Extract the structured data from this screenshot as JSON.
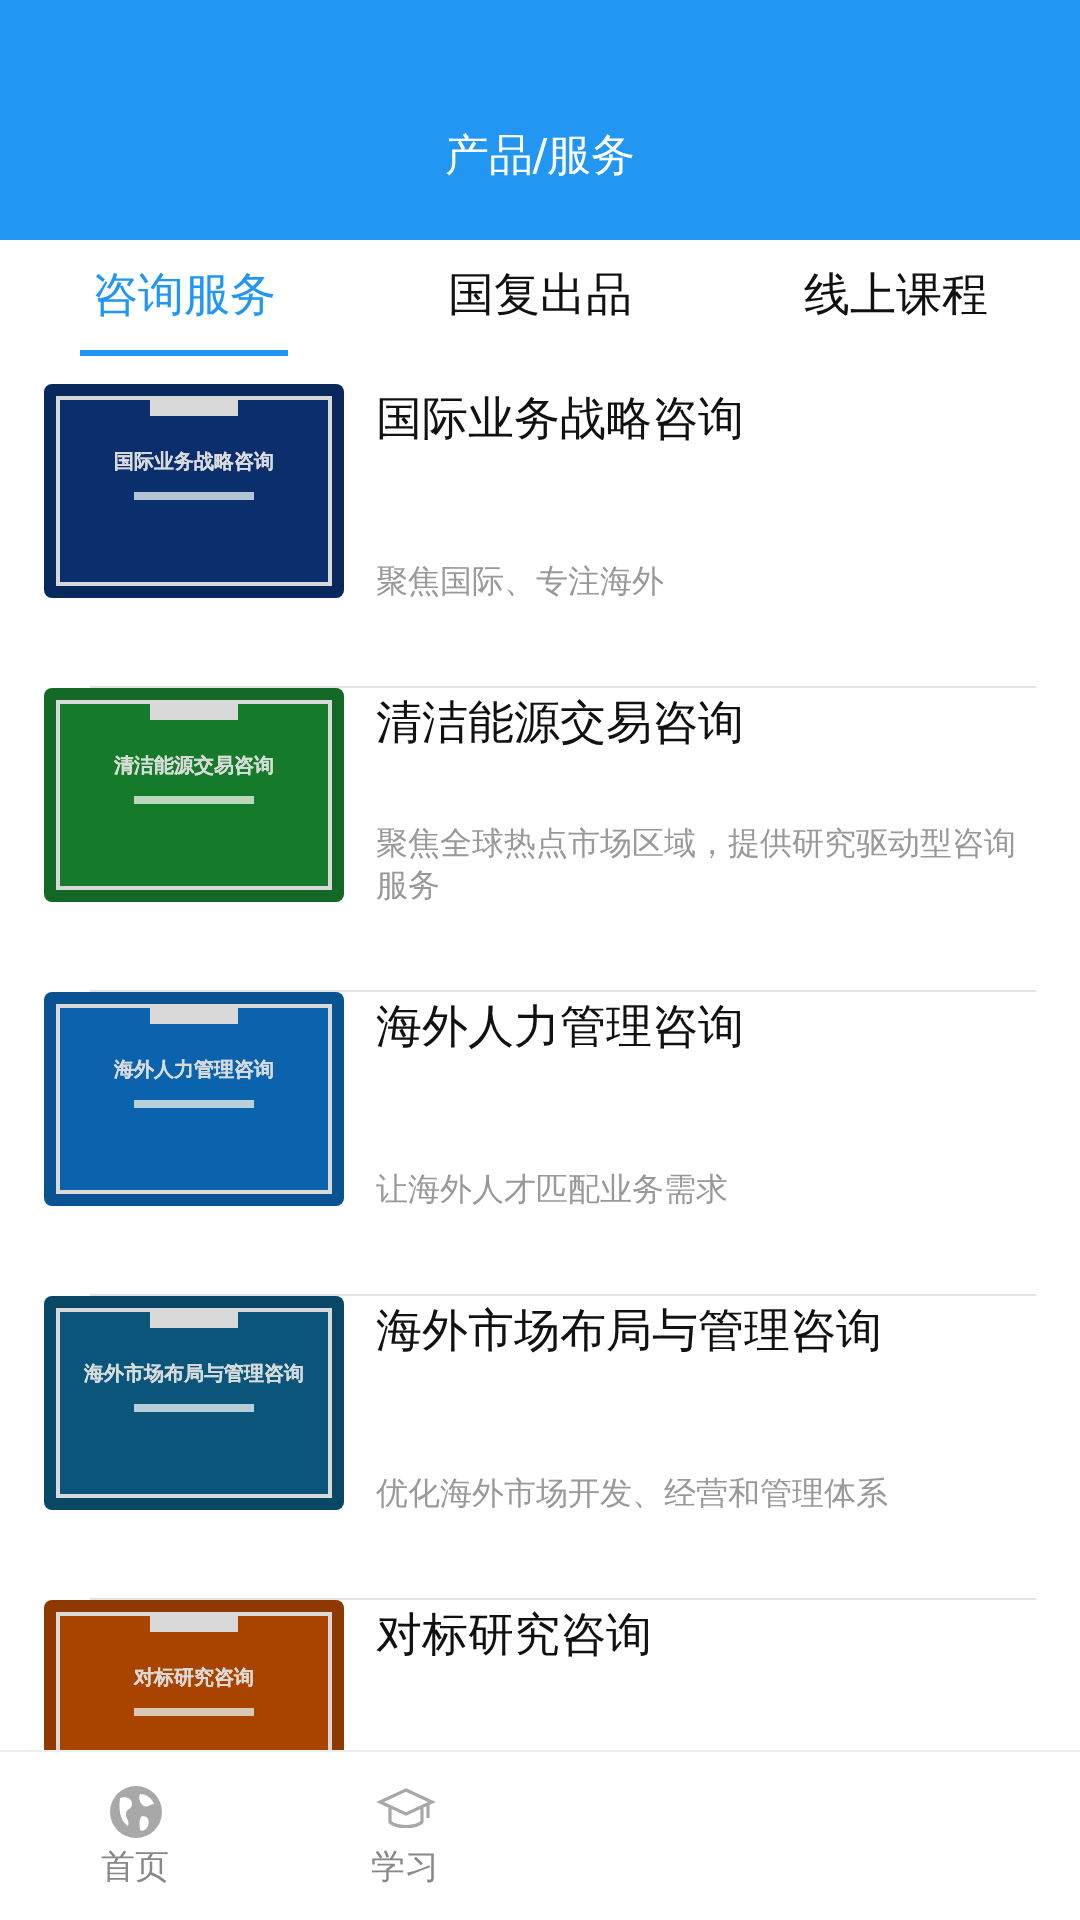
{
  "header": {
    "title": "产品/服务"
  },
  "tabs": [
    {
      "label": "咨询服务",
      "selected": true
    },
    {
      "label": "国复出品",
      "selected": false
    },
    {
      "label": "线上课程",
      "selected": false
    }
  ],
  "items": [
    {
      "title": "国际业务战略咨询",
      "description": "聚焦国际、专注海外",
      "thumb_title": "国际业务战略咨询",
      "color": "#0b2f6c"
    },
    {
      "title": "清洁能源交易咨询",
      "description": "聚焦全球热点市场区域，提供研究驱动型咨询服务",
      "thumb_title": "清洁能源交易咨询",
      "color": "#167a2b"
    },
    {
      "title": "海外人力管理咨询",
      "description": "让海外人才匹配业务需求",
      "thumb_title": "海外人力管理咨询",
      "color": "#0b62ac"
    },
    {
      "title": "海外市场布局与管理咨询",
      "description": "优化海外市场开发、经营和管理体系",
      "thumb_title": "海外市场布局与管理咨询",
      "color": "#0a5578"
    },
    {
      "title": "对标研究咨询",
      "thumb_title": "对标研究咨询",
      "color": "#a84300"
    }
  ],
  "bottom_nav": [
    {
      "label": "首页",
      "kind": "globe"
    },
    {
      "label": "学习",
      "kind": "cap"
    }
  ]
}
